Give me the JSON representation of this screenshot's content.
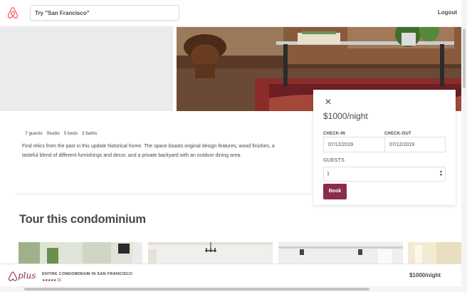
{
  "header": {
    "search_placeholder": "Try \"San Francisco\"",
    "logout_label": "Logout"
  },
  "listing": {
    "facts": [
      "7 guests",
      "Studio",
      "5 beds",
      "3 baths"
    ],
    "description": "Find relics from the past in this update historical home. The space boasts original design features, wood finishes, a tasteful blend of different furnishings and decor, and a private backyard with an outdoor dining area.",
    "tour_title": "Tour this condominium"
  },
  "booking": {
    "close_icon": "close-icon",
    "price": "$1000/night",
    "checkin_label": "CHECK-IN",
    "checkin_value": "07/12/2019",
    "checkout_label": "CHECK-OUT",
    "checkout_value": "07/12/2019",
    "guests_label": "GUESTS",
    "guests_value": "1",
    "book_label": "Book"
  },
  "footer": {
    "logo_text": "plus",
    "title": "ENTIRE CONDOMINIUM IN SAN FRANCISCO",
    "stars": "★★★★★",
    "review_count": "15",
    "price": "$1000/night"
  },
  "colors": {
    "brand": "#ff5a5f",
    "plus": "#8a2b50",
    "text": "#484848"
  }
}
